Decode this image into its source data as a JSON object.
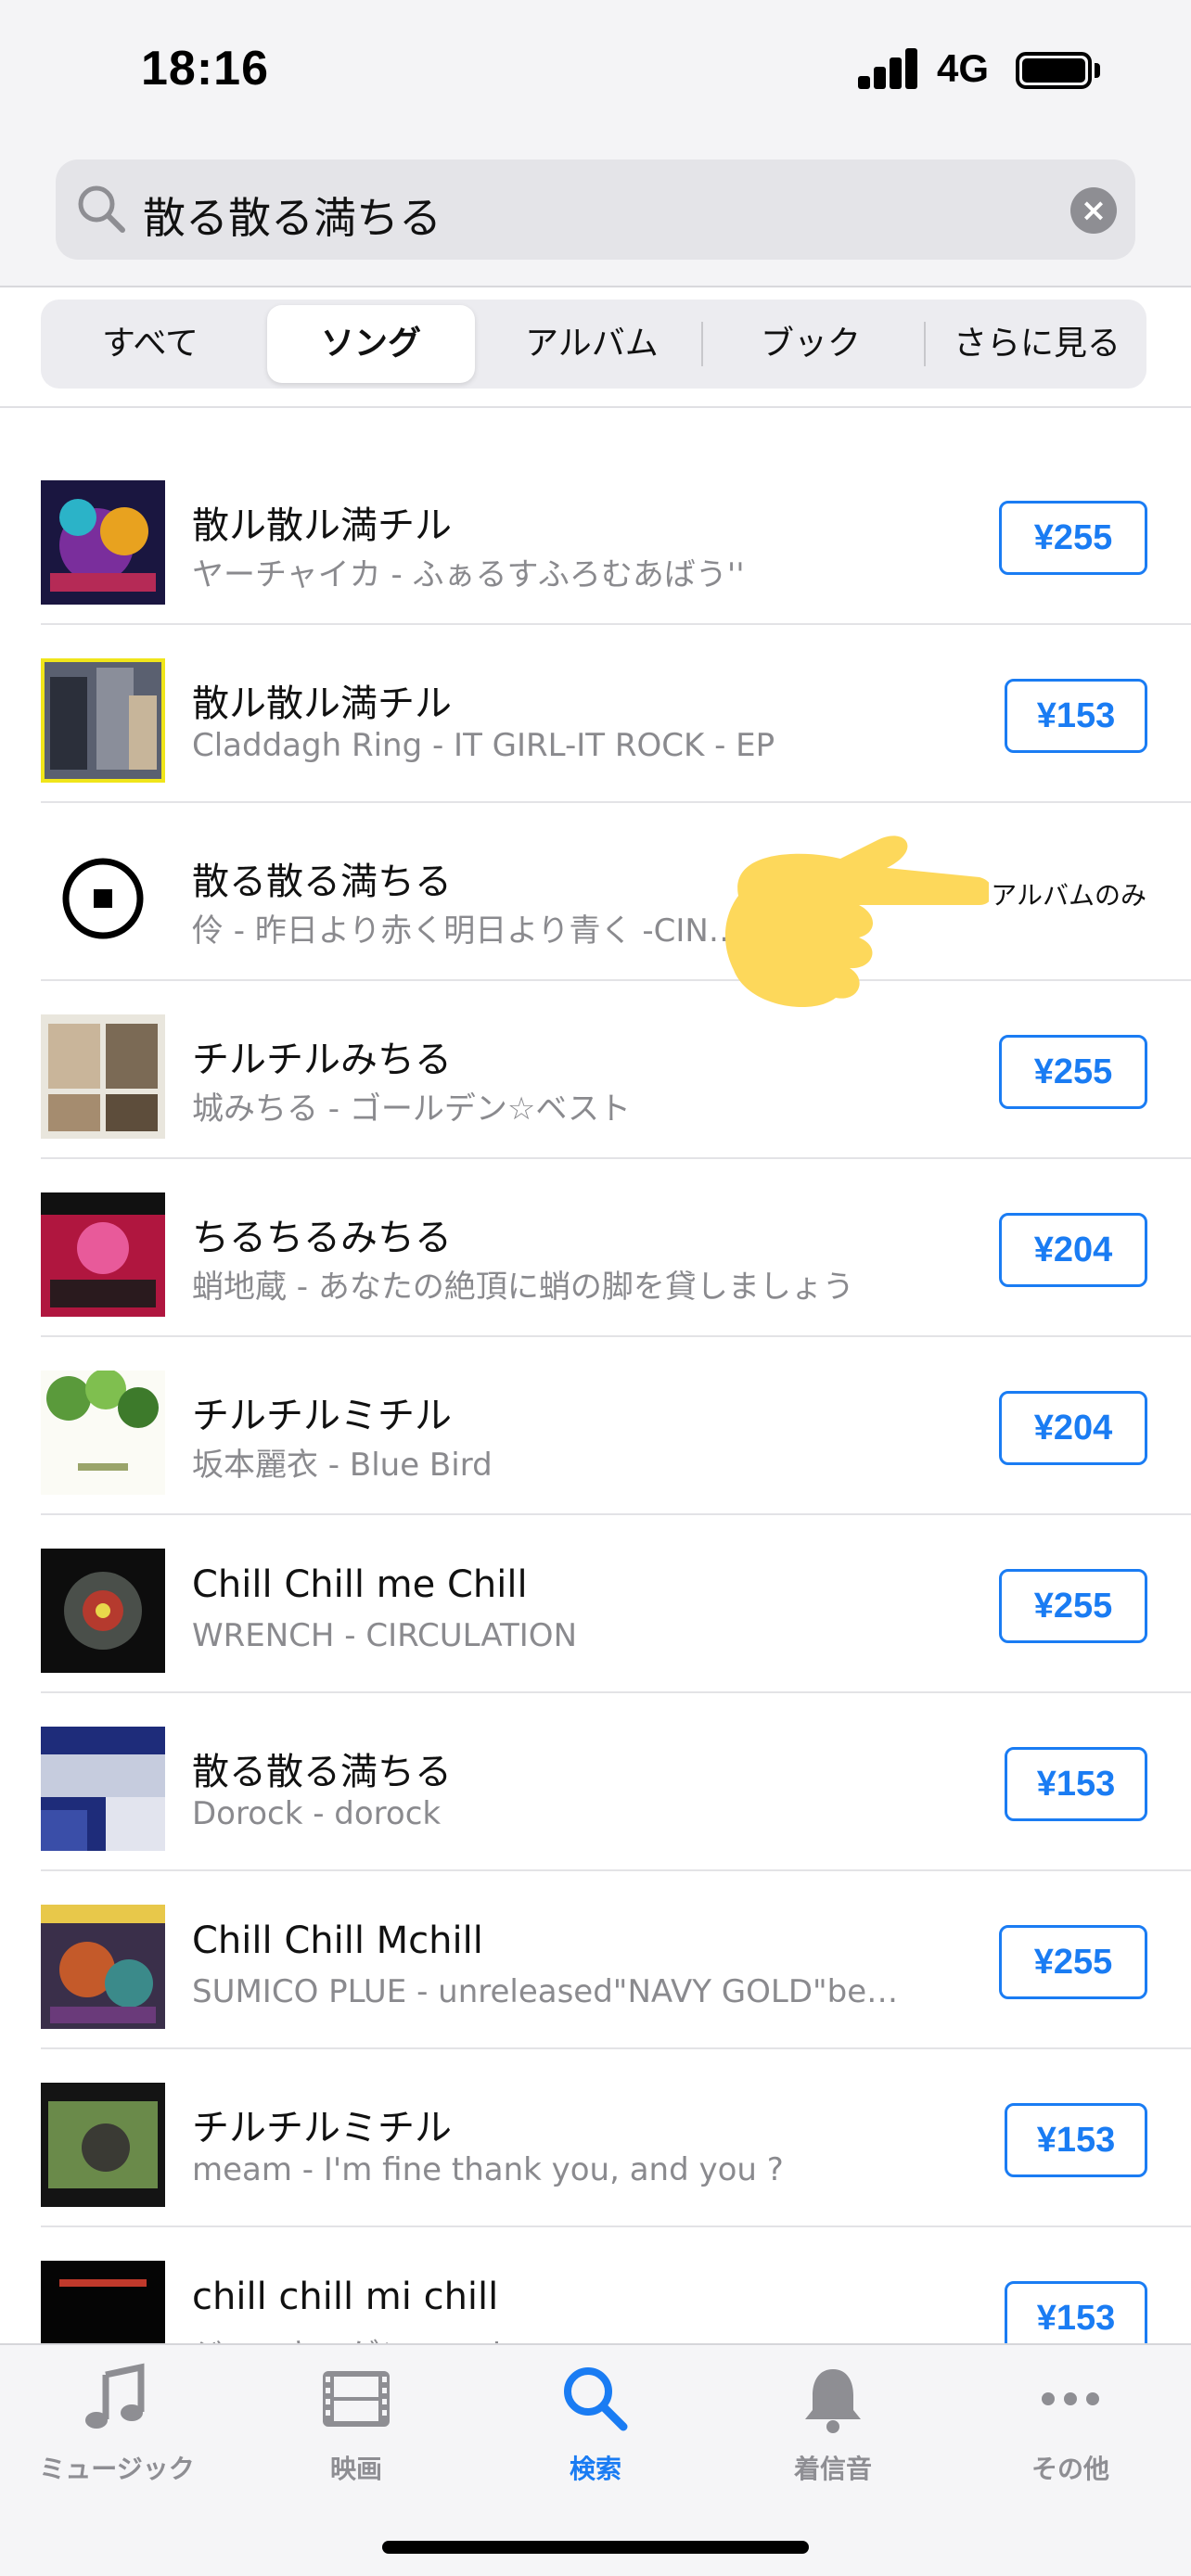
{
  "status": {
    "time": "18:16",
    "network": "4G"
  },
  "search": {
    "query": "散る散る満ちる"
  },
  "segments": [
    "すべて",
    "ソング",
    "アルバム",
    "ブック",
    "さらに見る"
  ],
  "results": [
    {
      "title": "散ル散ル満チル",
      "subtitle": "ヤーチャイカ - ふぁるすふろむあばう''",
      "price": "¥255",
      "art": "art-1"
    },
    {
      "title": "散ル散ル満チル",
      "subtitle": "Claddagh Ring - IT GIRL-IT ROCK - EP",
      "price": "¥153",
      "art": "art-2"
    },
    {
      "title": "散る散る満ちる",
      "subtitle": "伶 - 昨日より赤く明日より青く -CIN…",
      "price": "",
      "note": "アルバムのみ",
      "art": "art-3"
    },
    {
      "title": "チルチルみちる",
      "subtitle": "城みちる - ゴールデン☆ベスト",
      "price": "¥255",
      "art": "art-4"
    },
    {
      "title": "ちるちるみちる",
      "subtitle": "蛸地蔵 - あなたの絶頂に蛸の脚を貸しましょう",
      "price": "¥204",
      "art": "art-5"
    },
    {
      "title": "チルチルミチル",
      "subtitle": "坂本麗衣 - Blue Bird",
      "price": "¥204",
      "art": "art-6"
    },
    {
      "title": "Chill Chill me Chill",
      "subtitle": "WRENCH - CIRCULATION",
      "price": "¥255",
      "art": "art-7"
    },
    {
      "title": "散る散る満ちる",
      "subtitle": "Dorock - dorock",
      "price": "¥153",
      "art": "art-8"
    },
    {
      "title": "Chill Chill Mchill",
      "subtitle": "SUMICO PLUE - unreleased\"NAVY GOLD\"be…",
      "price": "¥255",
      "art": "art-9"
    },
    {
      "title": "チルチルミチル",
      "subtitle": "meam - I'm fine thank you, and you ?",
      "price": "¥153",
      "art": "art-10"
    },
    {
      "title": "chill chill mi chill",
      "subtitle": "ジャッキーゲン - caricatures",
      "price": "¥153",
      "art": "art-11"
    }
  ],
  "tabs": [
    "ミュージック",
    "映画",
    "検索",
    "着信音",
    "その他"
  ],
  "colors": {
    "accent": "#1a7cf3",
    "secondary_text": "#8a8a8e",
    "hand": "#fdd85b"
  },
  "icons": [
    "search-icon",
    "clear-icon",
    "music-note-icon",
    "film-icon",
    "search-tab-icon",
    "bell-icon",
    "more-icon",
    "pointing-hand-icon"
  ]
}
